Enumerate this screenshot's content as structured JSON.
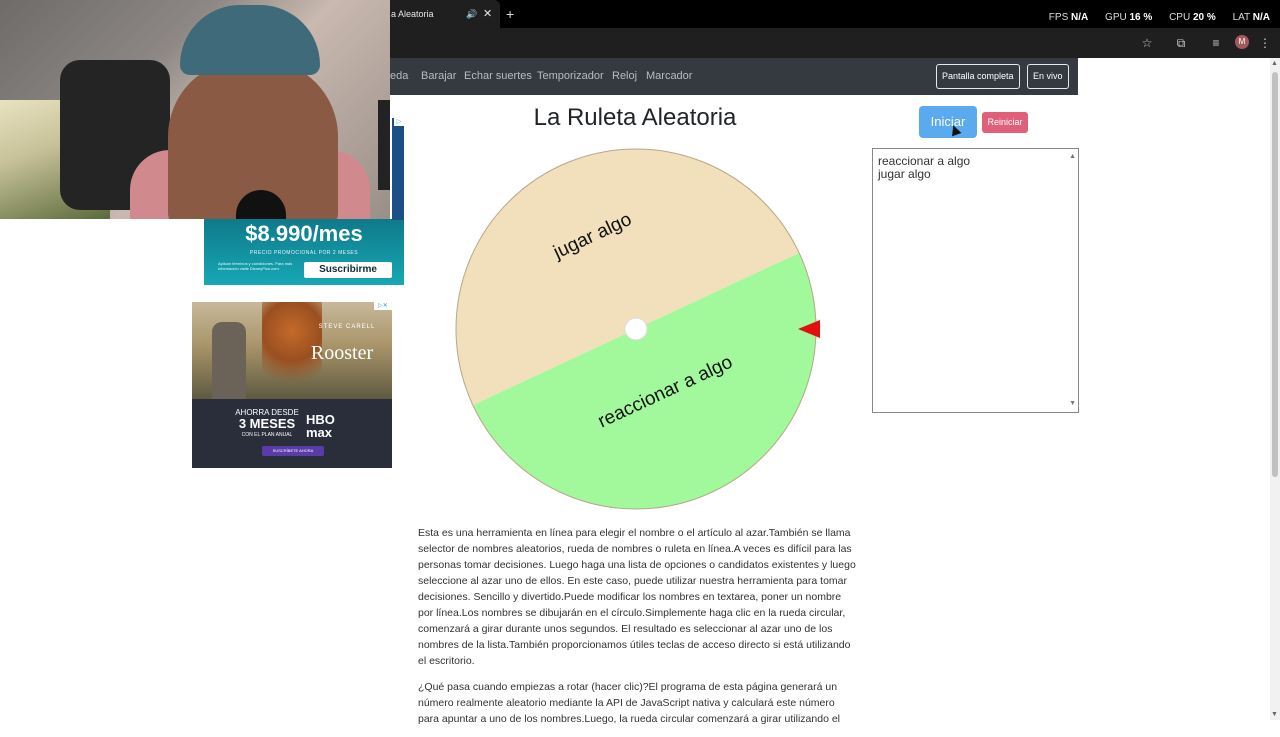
{
  "browser": {
    "tab_title": "a Aleatoria",
    "audio_icon": "speaker-icon",
    "new_tab_label": "+",
    "perf": {
      "fps_label": "FPS",
      "fps_value": "N/A",
      "gpu_label": "GPU",
      "gpu_value": "16 %",
      "cpu_label": "CPU",
      "cpu_value": "20 %",
      "lat_label": "LAT",
      "lat_value": "N/A"
    },
    "avatar_letter": "M"
  },
  "navbar": {
    "links": [
      "eda",
      "Barajar",
      "Echar suertes",
      "Temporizador",
      "Reloj",
      "Marcador"
    ],
    "fullscreen_label": "Pantalla completa",
    "live_label": "En vivo"
  },
  "ads": {
    "ad1": {
      "price": "$8.990/mes",
      "promo": "PRECIO PROMOCIONAL POR 2 MESES",
      "legal": "Aplican términos y condiciones. Para más información visite DisneyPlus.com.",
      "cta": "Suscribirme"
    },
    "ad2": {
      "starring": "STEVE CARELL",
      "title": "Rooster",
      "offer_line1": "AHORRA DESDE",
      "offer_line2": "3 MESES",
      "offer_line3": "CON EL PLAN ANUAL",
      "brand": "HBO max",
      "cta": "SUSCRÍBETE AHORA"
    }
  },
  "main": {
    "title": "La Ruleta Aleatoria",
    "start_label": "Iniciar",
    "reset_label": "Reiniciar",
    "names": [
      "reaccionar a algo",
      "jugar algo"
    ]
  },
  "wheel": {
    "segments": [
      {
        "label": "jugar algo",
        "color": "#f2dfbc"
      },
      {
        "label": "reaccionar a algo",
        "color": "#a2f99b"
      }
    ],
    "pointer_color": "#e01010"
  },
  "description": {
    "p1": "Esta es una herramienta en línea para elegir el nombre o el artículo al azar.También se llama selector de nombres aleatorios, rueda de nombres o ruleta en línea.A veces es difícil para las personas tomar decisiones. Luego haga una lista de opciones o candidatos existentes y luego seleccione al azar uno de ellos. En este caso, puede utilizar nuestra herramienta para tomar decisiones. Sencillo y divertido.Puede modificar los nombres en textarea, poner un nombre por línea.Los nombres se dibujarán en el círculo.Simplemente haga clic en la rueda circular, comenzará a girar durante unos segundos. El resultado es seleccionar al azar uno de los nombres de la lista.También proporcionamos útiles teclas de acceso directo si está utilizando el escritorio.",
    "p2": "¿Qué pasa cuando empiezas a rotar (hacer clic)?El programa de esta página generará un número realmente aleatorio mediante la API de JavaScript nativa y calculará este número para apuntar a uno de los nombres.Luego, la rueda circular comenzará a girar utilizando el"
  }
}
